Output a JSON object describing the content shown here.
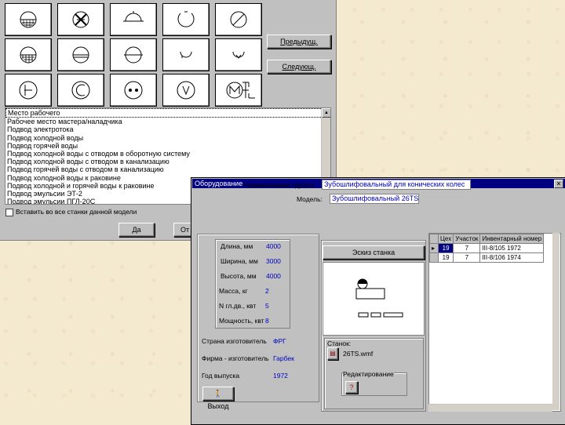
{
  "window1": {
    "prev_label": "Предыдущ.",
    "next_label": "Следующ.",
    "ok_label": "Да",
    "cancel_label": "От",
    "apply_all_label": "Вставить во все станки данной модели",
    "list_items": [
      "Место рабочего",
      "Рабочее место мастера/наладчика",
      "Подвод электротока",
      "Подвод холодной воды",
      "Подвод горячей воды",
      "Подвод холодной воды с отводом в оборотную систему",
      "Подвод холодной воды с отводом в канализацию",
      "Подвод горячей воды с отводом в канализацию",
      "Подвод холодной воды к раковине",
      "Подвод холодной и горячей воды к раковине",
      "Подвод эмульсии ЭТ-2",
      "Подвод эмульсии ПГЛ-20С"
    ],
    "symbol_icons": [
      "hatched-circle-icon",
      "crossed-circle-icon",
      "semicircle-hash-icon",
      "arc-circle-icon",
      "slashed-circle-icon",
      "hatched-half-circle-icon",
      "split-circle-icon",
      "cup-circle-icon",
      "cup-icon",
      "v-cup-icon",
      "theta-circle-icon",
      "c-circle-icon",
      "socket-icon",
      "v-circle-icon",
      "motor-pump-icon"
    ]
  },
  "window2": {
    "title": "Оборудование",
    "group_label": "Наименование группы",
    "group_value": "Зубошлифовальный для конических колес",
    "model_label": "Модель:",
    "model_value": "Зубошлифовальный 26TS",
    "dims": [
      {
        "label": "Длина, мм",
        "value": "4000"
      },
      {
        "label": "Ширина, мм",
        "value": "3000"
      },
      {
        "label": "Высота, мм",
        "value": "4000"
      }
    ],
    "specs": [
      {
        "label": "Масса, кг",
        "value": "2"
      },
      {
        "label": "N гл.дв., квт",
        "value": "5"
      },
      {
        "label": "Мощность, квт",
        "value": "8"
      }
    ],
    "origin": [
      {
        "label": "Страна изготовитель",
        "value": "ФРГ"
      },
      {
        "label": "Фирма - изготовитель",
        "value": "Гарбек"
      },
      {
        "label": "Год выпуска",
        "value": "1972"
      }
    ],
    "sketch_label": "Эскиз станка",
    "machine_label": "Станок:",
    "machine_file": "26TS.wmf",
    "edit_label": "Редактирование",
    "exit_label": "Выход",
    "table": {
      "columns": [
        "Цех",
        "Участок",
        "Инвентарный номер"
      ],
      "rows": [
        [
          "19",
          "7",
          "III-8/105 1972"
        ],
        [
          "19",
          "7",
          "III-8/106 1974"
        ]
      ]
    },
    "colors": {
      "titlebar": "#000080",
      "values": "#0000c0"
    }
  }
}
